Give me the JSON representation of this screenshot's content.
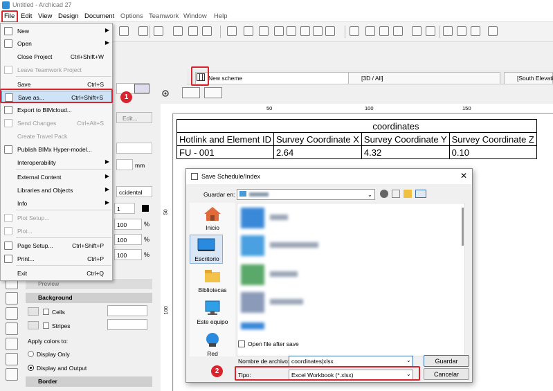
{
  "window": {
    "title": "Untitled - Archicad 27"
  },
  "menubar": {
    "items": [
      "File",
      "Edit",
      "View",
      "Design",
      "Document",
      "Options",
      "Teamwork",
      "Window",
      "Help"
    ]
  },
  "file_menu": {
    "items": [
      {
        "label": "New",
        "shortcut": "",
        "submenu": true,
        "disabled": false
      },
      {
        "label": "Open",
        "shortcut": "",
        "submenu": true,
        "disabled": false
      },
      {
        "label": "Close Project",
        "shortcut": "Ctrl+Shift+W",
        "submenu": false,
        "disabled": false
      },
      {
        "label": "Leave Teamwork Project",
        "shortcut": "",
        "submenu": false,
        "disabled": true
      },
      {
        "label": "Save",
        "shortcut": "Ctrl+S",
        "submenu": false,
        "disabled": false
      },
      {
        "label": "Save as...",
        "shortcut": "Ctrl+Shift+S",
        "submenu": false,
        "disabled": false,
        "highlighted": true
      },
      {
        "label": "Export to BIMcloud...",
        "shortcut": "",
        "submenu": false,
        "disabled": false
      },
      {
        "label": "Send Changes",
        "shortcut": "Ctrl+Alt+S",
        "submenu": false,
        "disabled": true
      },
      {
        "label": "Create Travel Pack",
        "shortcut": "",
        "submenu": false,
        "disabled": true
      },
      {
        "label": "Publish BIMx Hyper-model...",
        "shortcut": "",
        "submenu": false,
        "disabled": false
      },
      {
        "label": "Interoperability",
        "shortcut": "",
        "submenu": true,
        "disabled": false
      },
      {
        "label": "External Content",
        "shortcut": "",
        "submenu": true,
        "disabled": false
      },
      {
        "label": "Libraries and Objects",
        "shortcut": "",
        "submenu": true,
        "disabled": false
      },
      {
        "label": "Info",
        "shortcut": "",
        "submenu": true,
        "disabled": false
      },
      {
        "label": "Plot Setup...",
        "shortcut": "",
        "submenu": false,
        "disabled": true
      },
      {
        "label": "Plot...",
        "shortcut": "",
        "submenu": false,
        "disabled": true
      },
      {
        "label": "Page Setup...",
        "shortcut": "Ctrl+Shift+P",
        "submenu": false,
        "disabled": false
      },
      {
        "label": "Print...",
        "shortcut": "Ctrl+P",
        "submenu": false,
        "disabled": false
      },
      {
        "label": "Exit",
        "shortcut": "Ctrl+Q",
        "submenu": false,
        "disabled": false
      }
    ]
  },
  "tabs": [
    {
      "label": "New scheme"
    },
    {
      "label": "[3D / All]"
    },
    {
      "label": "[South Elevation"
    }
  ],
  "ruler": {
    "h_labels": [
      "50",
      "100",
      "150"
    ],
    "v_labels": [
      "50",
      "100"
    ]
  },
  "schedule": {
    "title": "coordinates",
    "headers": [
      "Hotlink and Element ID",
      "Survey Coordinate X",
      "Survey Coordinate Y",
      "Survey Coordinate Z"
    ],
    "rows": [
      [
        "FU - 001",
        "2.64",
        "4.32",
        "0.10"
      ]
    ]
  },
  "panel": {
    "edit_label": "Edit...",
    "unit_mm": "mm",
    "dropdown_value": "ccidental",
    "num1": "1",
    "pct1": "100",
    "pct2": "100",
    "pct3": "100",
    "pct_sign": "%",
    "preview_label": "Preview",
    "background_label": "Background",
    "cells_label": "Cells",
    "stripes_label": "Stripes",
    "apply_colors_label": "Apply colors to:",
    "display_only": "Display Only",
    "display_output": "Display and Output",
    "border_label": "Border"
  },
  "dialog": {
    "title": "Save Schedule/Index",
    "save_in_label": "Guardar en:",
    "places": [
      {
        "label": "Inicio"
      },
      {
        "label": "Escritorio"
      },
      {
        "label": "Bibliotecas"
      },
      {
        "label": "Este equipo"
      },
      {
        "label": "Red"
      }
    ],
    "open_after_save_label": "Open file after save",
    "filename_label": "Nombre de archivo:",
    "filename_value": "coordinates|xlsx",
    "type_label": "Tipo:",
    "type_value": "Excel Workbook (*.xlsx)",
    "save_button": "Guardar",
    "cancel_button": "Cancelar"
  },
  "badges": {
    "one": "1",
    "two": "2"
  },
  "colors": {
    "highlight_red": "#d9232d",
    "menu_highlight": "#cfe3f7",
    "accent_blue": "#2f8fd6"
  }
}
